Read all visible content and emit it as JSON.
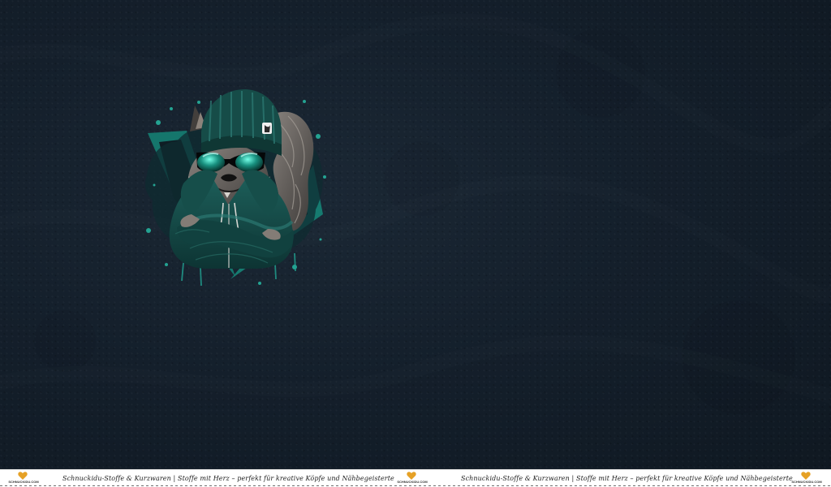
{
  "artwork": {
    "subject": "squirrel wearing teal beanie, sunglasses and zip hoodie with arms crossed",
    "palette": {
      "background": "#121c27",
      "teal": "#1f8f80",
      "dark_teal": "#123f3d",
      "fur": "#6d6862",
      "black": "#050708"
    }
  },
  "selvage": {
    "logo_label": "SCHNUCKIDU.COM",
    "brand": "Schnuckidu-Stoffe & Kurzwaren",
    "separator": "|",
    "slogan": "Stoffe mit Herz – perfekt für kreative Köpfe und Nähbegeisterte",
    "logo_color": "#e6a126"
  }
}
